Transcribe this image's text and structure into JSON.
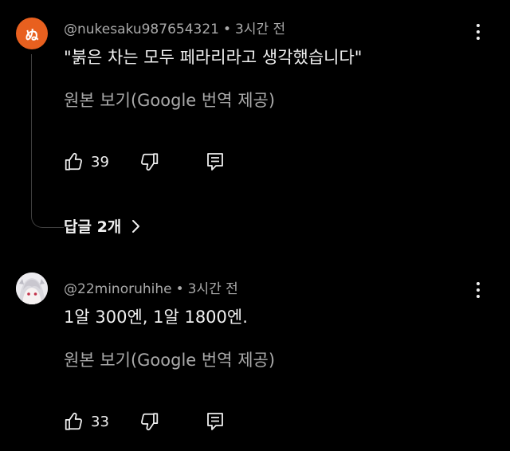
{
  "comments": [
    {
      "avatar_glyph": "ぬ",
      "avatar_color": "#e8601f",
      "author": "@nukesaku987654321",
      "separator": "•",
      "time": "3시간 전",
      "text": "\"붉은 차는 모두 페라리라고 생각했습니다\"",
      "translate_label": "원본 보기(Google 번역 제공)",
      "likes": "39",
      "replies_label": "답글 2개"
    },
    {
      "avatar_glyph": "",
      "avatar_color": "#e9e9ec",
      "author": "@22minoruhihe",
      "separator": "•",
      "time": "3시간 전",
      "text": "1알 300엔, 1알 1800엔.",
      "translate_label": "원본 보기(Google 번역 제공)",
      "likes": "33"
    }
  ],
  "icons": {
    "more": "more-vert-icon",
    "like": "thumb-up-icon",
    "dislike": "thumb-down-icon",
    "reply": "reply-comment-icon",
    "expand": "chevron-right-icon"
  },
  "colors": {
    "background": "#000000",
    "primary_text": "#f1f1f1",
    "secondary_text": "#aaaaaa",
    "thread_line": "#3f3f3f"
  }
}
